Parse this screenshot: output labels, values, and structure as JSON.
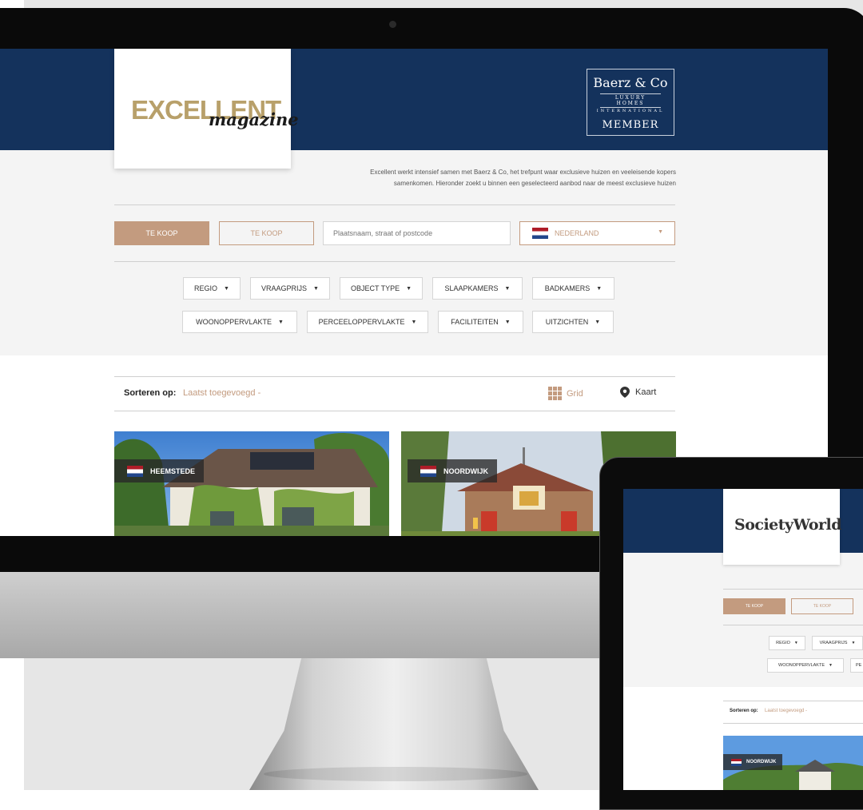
{
  "site": {
    "logo_main": "EXCELLENT",
    "logo_sub": "magazine",
    "member": {
      "brand": "Baerz & Co",
      "line1": "LUXURY HOMES",
      "line2": "INTERNATIONAL",
      "label": "MEMBER"
    },
    "intro_line1": "Excellent werkt intensief samen met Baerz & Co, het trefpunt waar exclusieve huizen en veeleisende kopers",
    "intro_line2": "samenkomen. Hieronder zoekt u binnen een geselecteerd aanbod naar de meest exclusieve huizen"
  },
  "search": {
    "buy_tab": "TE KOOP",
    "buy_tab_outline": "TE KOOP",
    "location_placeholder": "Plaatsnaam, straat of postcode",
    "country": "NEDERLAND"
  },
  "filters_row1": [
    "REGIO",
    "VRAAGPRIJS",
    "OBJECT TYPE",
    "SLAAPKAMERS",
    "BADKAMERS"
  ],
  "filters_row2": [
    "WOONOPPERVLAKTE",
    "PERCEELOPPERVLAKTE",
    "FACILITEITEN",
    "UITZICHTEN"
  ],
  "sort": {
    "label": "Sorteren op:",
    "value": "Laatst toegevoegd -",
    "grid": "Grid",
    "map": "Kaart"
  },
  "listings": [
    {
      "location": "HEEMSTEDE"
    },
    {
      "location": "NOORDWIJK"
    }
  ],
  "tablet": {
    "logo": "SocietyWorld",
    "buy_tab": "TE KOOP",
    "buy_tab_outline": "TE KOOP",
    "filters_row1": [
      "REGIO",
      "VRAAGPRIJS"
    ],
    "filters_row2": [
      "WOONOPPERVLAKTE",
      "PE"
    ],
    "sort_label": "Sorteren op:",
    "sort_value": "Laatst toegevoegd -",
    "listing": "NOORDWIJK"
  },
  "colors": {
    "navy": "#14325c",
    "accent": "#c39b7f",
    "logo_gold": "#b8a06a"
  }
}
